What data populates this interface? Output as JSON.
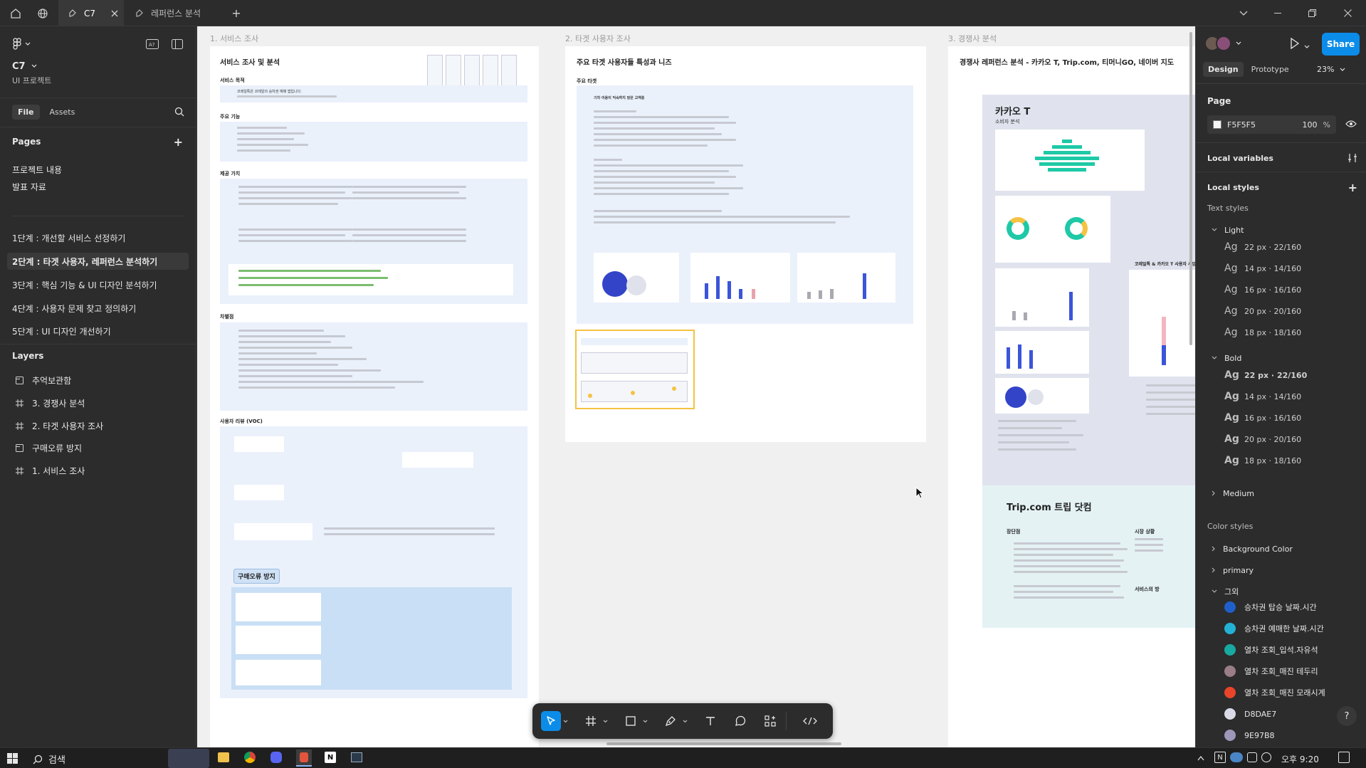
{
  "titlebar": {
    "tabs": [
      {
        "label": "C7",
        "active": true
      },
      {
        "label": "레퍼런스 분석",
        "active": false
      }
    ]
  },
  "left": {
    "file_name": "C7",
    "project": "UI 프로젝트",
    "tab_file": "File",
    "tab_assets": "Assets",
    "pages_title": "Pages",
    "pages": [
      {
        "label": "프로젝트 내용"
      },
      {
        "label": "발표 자료"
      },
      {
        "label": "1단계 : 개선할 서비스 선정하기"
      },
      {
        "label": "2단계 : 타겟 사용자, 레퍼런스 분석하기",
        "selected": true
      },
      {
        "label": "3단계 : 핵심 기능 & UI 디자인 분석하기"
      },
      {
        "label": "4단계 : 사용자 문제 찾고 정의하기"
      },
      {
        "label": "5단계 : UI 디자인 개선하기"
      }
    ],
    "layers_title": "Layers",
    "layers": [
      {
        "label": "추억보관함",
        "icon": "section-icon"
      },
      {
        "label": "3. 경쟁사 분석",
        "icon": "frame-icon"
      },
      {
        "label": "2. 타겟 사용자 조사",
        "icon": "frame-icon"
      },
      {
        "label": "구매오류 방지",
        "icon": "section-icon"
      },
      {
        "label": "1. 서비스 조사",
        "icon": "frame-icon"
      }
    ]
  },
  "canvas": {
    "frames": [
      {
        "label": "1. 서비스 조사",
        "title": "서비스 조사 및 분석",
        "sections": [
          "서비스 목적",
          "주요 기능",
          "제공 가치",
          "차별점",
          "사용자 리뷰 (VOC)"
        ],
        "purpose_text": "코레일톡은 코레일의 승차권 예매 앱입니다.",
        "callout": "구매오류 방지"
      },
      {
        "label": "2. 타겟 사용자 조사",
        "title": "주요 타겟 사용자들 특성과 니즈",
        "sub": "주요 타겟",
        "persona_title": "기차 이용이 익숙하지 않은 고객층"
      },
      {
        "label": "3. 경쟁사 분석",
        "title": "경쟁사 레퍼런스 분석 - 카카오 T, Trip.com, 티머니GO, 네이버 지도",
        "kakao_title": "카카오 T",
        "kakao_sub": "소비자 분석",
        "kakao_side": "코레일톡 & 카카오 T 사용자 사업",
        "trip_title": "Trip.com 트립 닷컴",
        "trip_pros": "장단점",
        "trip_market": "시장 상황",
        "trip_service": "서비스의 방"
      }
    ]
  },
  "right": {
    "tab_design": "Design",
    "tab_prototype": "Prototype",
    "zoom": "23%",
    "share": "Share",
    "page_title": "Page",
    "page_color": "F5F5F5",
    "page_opacity": "100",
    "percent": "%",
    "local_variables": "Local variables",
    "local_styles": "Local styles",
    "text_styles": "Text styles",
    "groups": [
      {
        "name": "Light",
        "expanded": true,
        "styles": [
          {
            "ag": "Ag",
            "label": "22 px · 22/160"
          },
          {
            "ag": "Ag",
            "label": "14 px · 14/160"
          },
          {
            "ag": "Ag",
            "label": "16 px · 16/160"
          },
          {
            "ag": "Ag",
            "label": "20 px · 20/160"
          },
          {
            "ag": "Ag",
            "label": "18 px · 18/160"
          }
        ]
      },
      {
        "name": "Bold",
        "expanded": true,
        "styles": [
          {
            "ag": "Ag",
            "label": "22 px · 22/160"
          },
          {
            "ag": "Ag",
            "label": "14 px · 14/160"
          },
          {
            "ag": "Ag",
            "label": "16 px · 16/160"
          },
          {
            "ag": "Ag",
            "label": "20 px · 20/160"
          },
          {
            "ag": "Ag",
            "label": "18 px · 18/160"
          }
        ]
      },
      {
        "name": "Medium",
        "expanded": false,
        "styles": []
      }
    ],
    "color_styles": "Color styles",
    "color_groups": [
      {
        "name": "Background Color",
        "expanded": false
      },
      {
        "name": "primary",
        "expanded": false
      },
      {
        "name": "그외",
        "expanded": true
      }
    ],
    "colors": [
      {
        "label": "승차권 탑승 날짜.시간",
        "hex": "#1f5fc9"
      },
      {
        "label": "승차권 예매한 날짜.시간",
        "hex": "#23b2d6"
      },
      {
        "label": "열차 조회_입석.자유석",
        "hex": "#18a9a3"
      },
      {
        "label": "열차 조회_매진 테두리",
        "hex": "#9a7d88"
      },
      {
        "label": "열차 조회_매진 모래시계",
        "hex": "#e8452b"
      },
      {
        "label": "D8DAE7",
        "hex": "#D8DAE7"
      },
      {
        "label": "9E97B8",
        "hex": "#9E97B8"
      }
    ]
  },
  "taskbar": {
    "search": "검색",
    "time": "오후 9:20"
  }
}
